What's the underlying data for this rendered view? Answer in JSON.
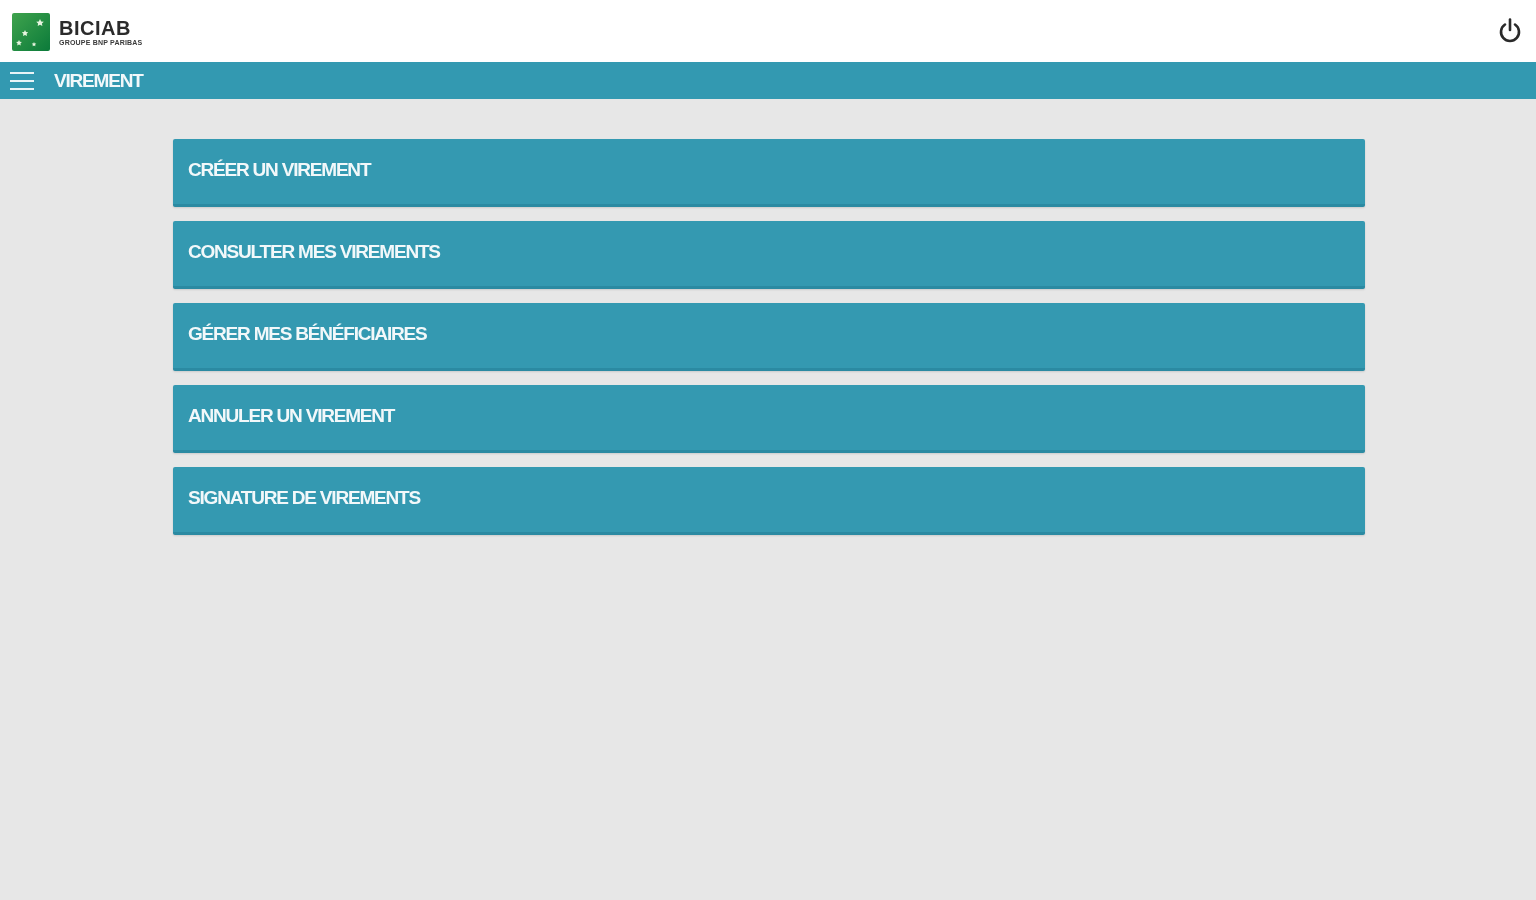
{
  "header": {
    "logo": {
      "name": "BICIAB",
      "tagline": "GROUPE BNP PARIBAS"
    }
  },
  "nav_bar": {
    "title": "VIREMENT"
  },
  "menu": [
    {
      "label": "CRÉER UN VIREMENT"
    },
    {
      "label": "CONSULTER MES VIREMENTS"
    },
    {
      "label": "GÉRER MES BÉNÉFICIAIRES"
    },
    {
      "label": "ANNULER UN VIREMENT"
    },
    {
      "label": "SIGNATURE DE VIREMENTS"
    }
  ]
}
